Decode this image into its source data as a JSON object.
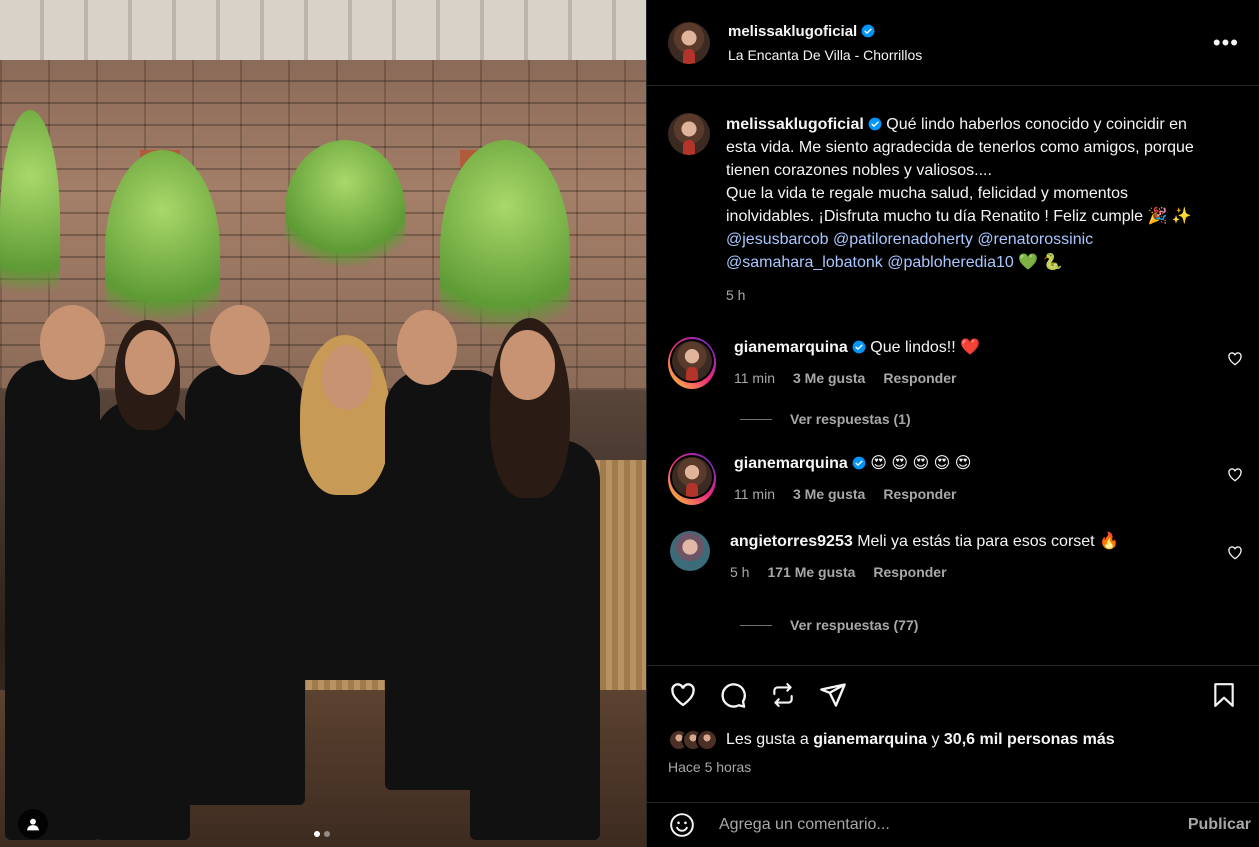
{
  "post": {
    "author": "melissaklugoficial",
    "location": "La Encanta De Villa - Chorrillos",
    "more_icon": "more-icon"
  },
  "caption": {
    "username": "melissaklugoficial",
    "text_line1": "Qué lindo haberlos conocido y coincidir en esta vida. Me siento agradecida de tenerlos como amigos, porque tienen corazones nobles y valiosos....",
    "text_line2": "Que la vida te regale mucha salud, felicidad y momentos inolvidables. ¡Disfruta mucho tu día Renatito ! Feliz cumple 🎉 ✨",
    "mentions": [
      "@jesusbarcob",
      "@patilorenadoherty",
      "@renatorossinic",
      "@samahara_lobatonk",
      "@pabloheredia10"
    ],
    "emojis_end": "💚 🐍",
    "time": "5 h"
  },
  "comments": [
    {
      "username": "gianemarquina",
      "verified": true,
      "text": "Que lindos!! ❤️",
      "time": "11 min",
      "likes": "3 Me gusta",
      "reply": "Responder",
      "view_replies": "Ver respuestas (1)"
    },
    {
      "username": "gianemarquina",
      "verified": true,
      "text": "😍 😍 😍 😍 😍",
      "time": "11 min",
      "likes": "3 Me gusta",
      "reply": "Responder",
      "view_replies": ""
    },
    {
      "username": "angietorres9253",
      "verified": false,
      "text": "Meli ya estás tia para esos corset 🔥",
      "time": "5 h",
      "likes": "171 Me gusta",
      "reply": "Responder",
      "view_replies": "Ver respuestas (77)"
    }
  ],
  "actions": {
    "liked_prefix": "Les gusta a",
    "liked_user": "gianemarquina",
    "liked_connector": "y",
    "liked_others": "30,6 mil personas más",
    "time_ago": "Hace 5 horas"
  },
  "composer": {
    "placeholder": "Agrega un comentario...",
    "publish": "Publicar"
  },
  "carousel": {
    "total": 2,
    "current": 1
  },
  "colors": {
    "background": "#000000",
    "text": "#f5f5f5",
    "muted": "#a8a8a8",
    "mention": "#a9c7ff",
    "verified": "#0095f6"
  }
}
